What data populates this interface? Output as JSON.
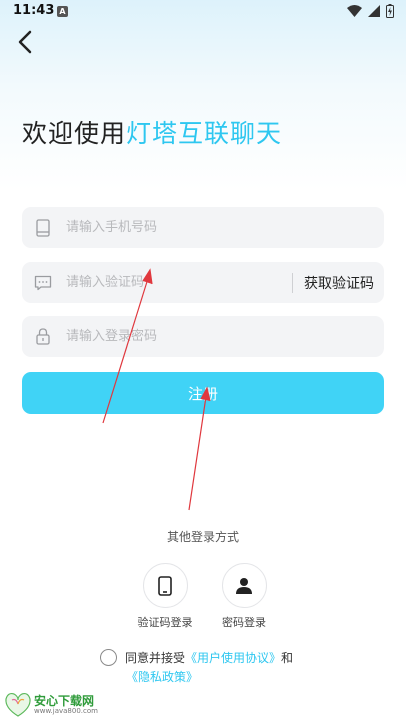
{
  "status_bar": {
    "time": "11:43",
    "notification_letter": "A"
  },
  "header": {
    "welcome_prefix": "欢迎使用",
    "brand_name": "灯塔互联聊天"
  },
  "form": {
    "phone_placeholder": "请输入手机号码",
    "code_placeholder": "请输入验证码",
    "get_code_label": "获取验证码",
    "password_placeholder": "请输入登录密码",
    "register_label": "注册"
  },
  "other_login": {
    "title": "其他登录方式",
    "options": [
      {
        "label": "验证码登录",
        "icon": "phone-icon"
      },
      {
        "label": "密码登录",
        "icon": "user-icon"
      }
    ]
  },
  "agreement": {
    "prefix": "同意并接受",
    "user_agreement": "《用户使用协议》",
    "and": "和",
    "privacy_policy": "《隐私政策》",
    "checked": false
  },
  "watermark": {
    "title": "安心下载网",
    "url": "www.java800.com"
  },
  "colors": {
    "accent": "#40d3f6",
    "brand_text": "#2ec7f0",
    "annotation_arrow": "#e0383e"
  }
}
